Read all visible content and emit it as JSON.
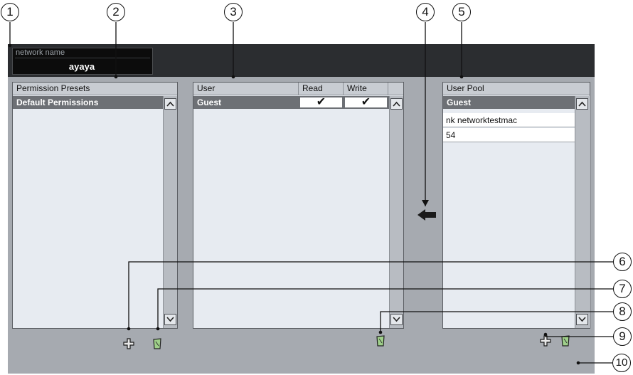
{
  "network": {
    "label": "network name",
    "value": "ayaya"
  },
  "presets": {
    "header": "Permission Presets",
    "items": [
      "Default Permissions"
    ]
  },
  "users": {
    "headers": {
      "user": "User",
      "read": "Read",
      "write": "Write"
    },
    "rows": [
      {
        "name": "Guest",
        "read": "✔",
        "write": "✔"
      }
    ]
  },
  "pool": {
    "header": "User Pool",
    "items": [
      "Guest",
      "nk networktestmac",
      "54"
    ]
  },
  "callouts": [
    "1",
    "2",
    "3",
    "4",
    "5",
    "6",
    "7",
    "8",
    "9",
    "10"
  ],
  "icons": {
    "add": "plus-icon",
    "remove": "trash-icon",
    "transfer": "arrow-left-icon",
    "scroll_up": "chevron-up-icon",
    "scroll_down": "chevron-down-icon"
  },
  "colors": {
    "panel_bg": "#e7ebf1",
    "main_bg": "#a6aab0",
    "top_bar": "#2b2d30",
    "selected_row": "#6d7075"
  }
}
